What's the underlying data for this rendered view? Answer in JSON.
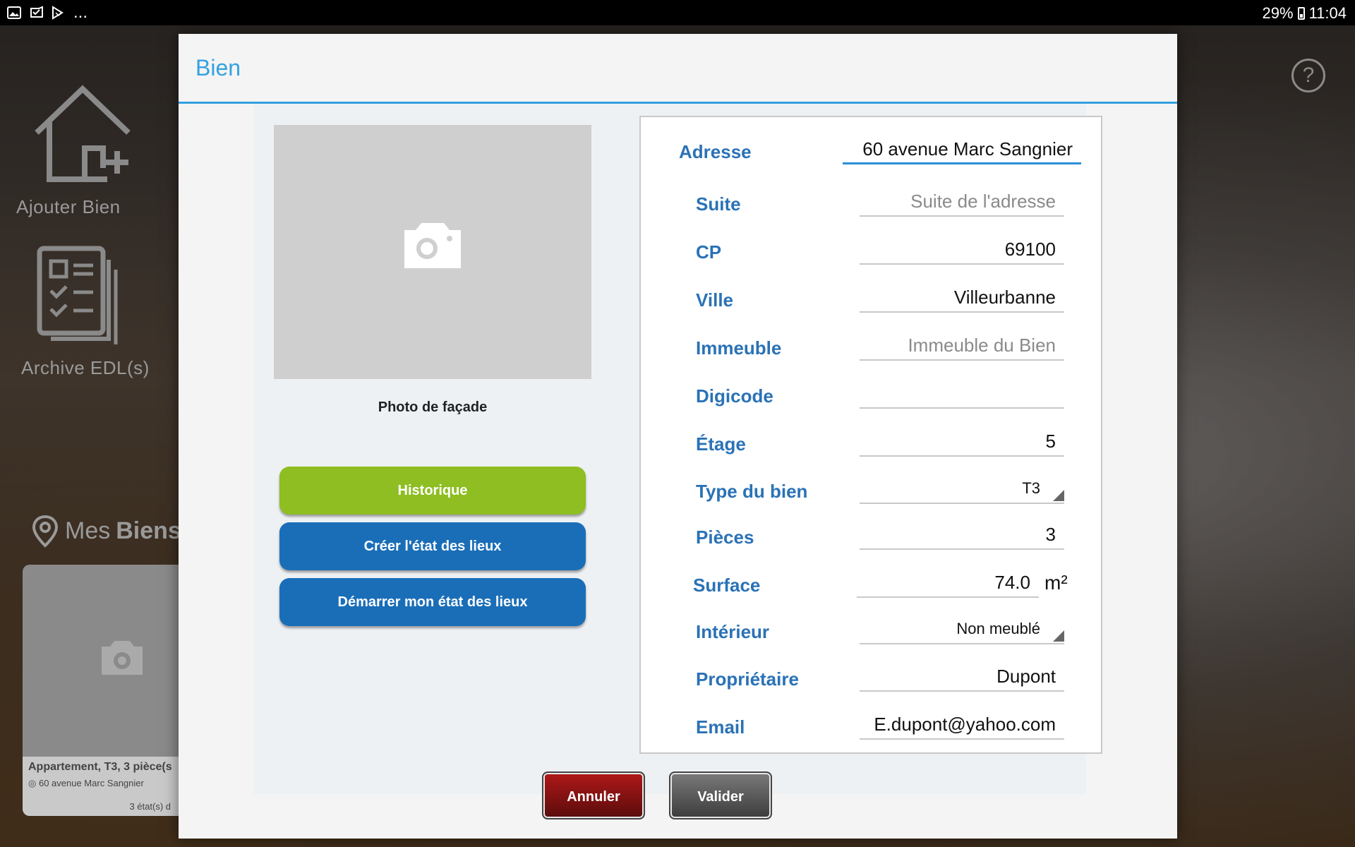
{
  "statusbar": {
    "battery": "29%",
    "time": "11:04",
    "overflow": "...",
    "icons": [
      "image-icon",
      "check-download-icon",
      "play-store-icon"
    ]
  },
  "background": {
    "add_label": "Ajouter Bien",
    "archive_label": "Archive EDL(s)",
    "section_title_light": "Mes",
    "section_title_bold": "Biens",
    "card": {
      "title": "Appartement, T3, 3 pièce(s",
      "address": "60 avenue Marc Sangnier",
      "count": "3 état(s) d"
    }
  },
  "modal": {
    "title": "Bien",
    "photo_label": "Photo de façade",
    "buttons": {
      "history": "Historique",
      "create": "Créer l'état des lieux",
      "start": "Démarrer mon état des lieux"
    },
    "fields": {
      "adresse": {
        "label": "Adresse",
        "value": "60 avenue Marc Sangnier"
      },
      "suite": {
        "label": "Suite",
        "placeholder": "Suite de l'adresse"
      },
      "cp": {
        "label": "CP",
        "value": "69100"
      },
      "ville": {
        "label": "Ville",
        "value": "Villeurbanne"
      },
      "immeuble": {
        "label": "Immeuble",
        "placeholder": "Immeuble du Bien"
      },
      "digicode": {
        "label": "Digicode",
        "value": ""
      },
      "etage": {
        "label": "Étage",
        "value": "5"
      },
      "type": {
        "label": "Type du bien",
        "value": "T3"
      },
      "pieces": {
        "label": "Pièces",
        "value": "3"
      },
      "surface": {
        "label": "Surface",
        "value": "74.0",
        "unit": "m²"
      },
      "interieur": {
        "label": "Intérieur",
        "value": "Non meublé"
      },
      "proprietaire": {
        "label": "Propriétaire",
        "value": "Dupont"
      },
      "email": {
        "label": "Email",
        "value": "E.dupont@yahoo.com"
      }
    },
    "footer": {
      "cancel": "Annuler",
      "ok": "Valider"
    }
  }
}
